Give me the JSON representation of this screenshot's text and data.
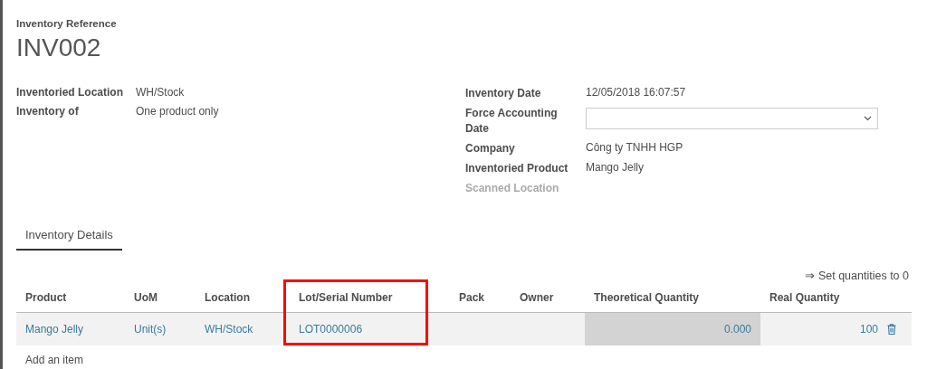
{
  "reference": {
    "label": "Inventory Reference",
    "value": "INV002"
  },
  "left_fields": [
    {
      "label": "Inventoried Location",
      "value": "WH/Stock"
    },
    {
      "label": "Inventory of",
      "value": "One product only"
    }
  ],
  "right_fields": [
    {
      "kind": "text",
      "label": "Inventory Date",
      "value": "12/05/2018 16:07:57",
      "disabled": false
    },
    {
      "kind": "select",
      "label": "Force Accounting Date",
      "disabled": false
    },
    {
      "kind": "text",
      "label": "Company",
      "value": "Công ty TNHH HGP",
      "disabled": false
    },
    {
      "kind": "text",
      "label": "Inventoried Product",
      "value": "Mango Jelly",
      "disabled": false
    },
    {
      "kind": "text",
      "label": "Scanned Location",
      "disabled": true
    }
  ],
  "tabs": [
    {
      "label": "Inventory Details",
      "selected": true
    }
  ],
  "set_quantities": "⇒ Set quantities to 0",
  "table": {
    "columns": [
      "Product",
      "UoM",
      "Location",
      "Lot/Serial Number",
      "Pack",
      "Owner",
      "Theoretical Quantity",
      "Real Quantity"
    ],
    "rows": [
      {
        "cells": [
          "Mango Jelly",
          "Unit(s)",
          "WH/Stock",
          "LOT0000006",
          "",
          "",
          "0.000",
          "100"
        ]
      }
    ],
    "add_item": "Add an item"
  }
}
